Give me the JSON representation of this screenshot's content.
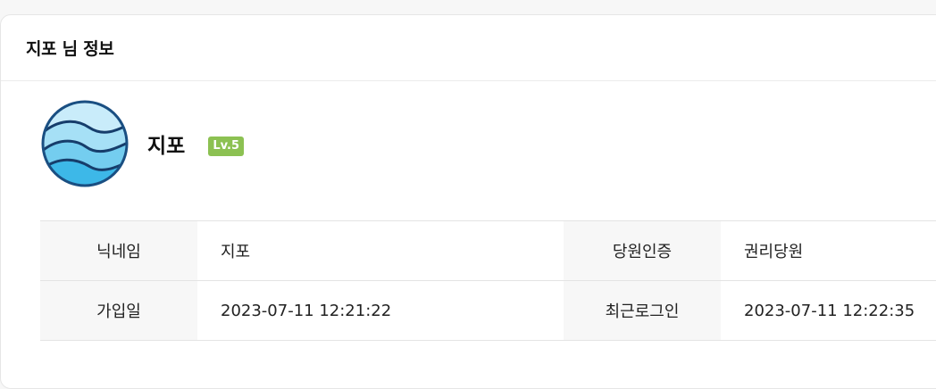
{
  "header": {
    "title": "지포 님 정보"
  },
  "profile": {
    "name": "지포",
    "level": "Lv.5",
    "avatar_icon": "wave-logo-icon"
  },
  "info": {
    "rows": [
      {
        "label1": "닉네임",
        "value1": "지포",
        "label2": "당원인증",
        "value2": "권리당원"
      },
      {
        "label1": "가입일",
        "value1": "2023-07-11 12:21:22",
        "label2": "최근로그인",
        "value2": "2023-07-11 12:22:35"
      }
    ]
  },
  "colors": {
    "badge": "#8cc152",
    "table_header_bg": "#f7f7f7"
  }
}
